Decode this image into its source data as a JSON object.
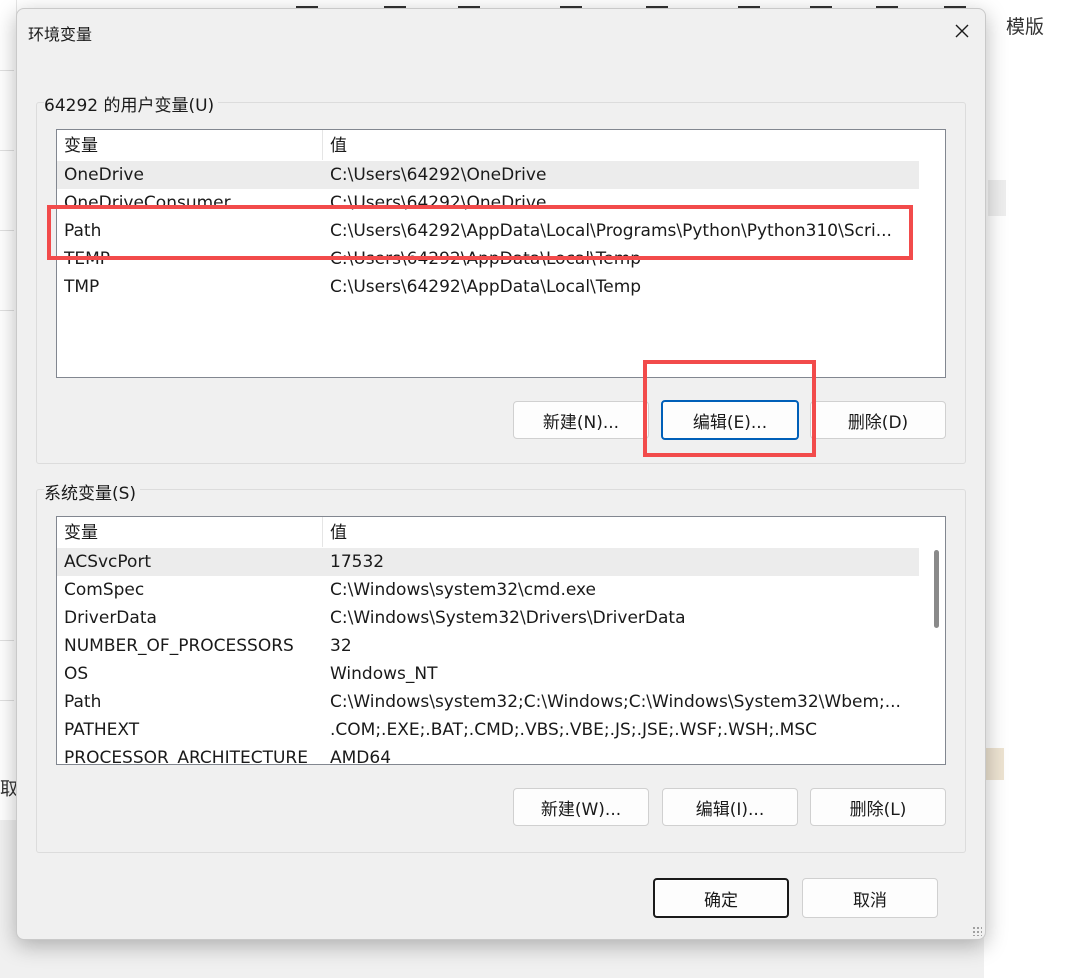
{
  "background": {
    "template_label": "模版",
    "left_partial_text": "取"
  },
  "dialog": {
    "title": "环境变量",
    "user_group": {
      "label": "64292 的用户变量(U)",
      "columns": [
        "变量",
        "值"
      ],
      "rows": [
        {
          "name": "OneDrive",
          "value": "C:\\Users\\64292\\OneDrive"
        },
        {
          "name": "OneDriveConsumer",
          "value": "C:\\Users\\64292\\OneDrive"
        },
        {
          "name": "Path",
          "value": "C:\\Users\\64292\\AppData\\Local\\Programs\\Python\\Python310\\Scri..."
        },
        {
          "name": "TEMP",
          "value": "C:\\Users\\64292\\AppData\\Local\\Temp"
        },
        {
          "name": "TMP",
          "value": "C:\\Users\\64292\\AppData\\Local\\Temp"
        }
      ],
      "buttons": {
        "new": "新建(N)...",
        "edit": "编辑(E)...",
        "delete": "删除(D)"
      }
    },
    "system_group": {
      "label": "系统变量(S)",
      "columns": [
        "变量",
        "值"
      ],
      "rows": [
        {
          "name": "ACSvcPort",
          "value": "17532"
        },
        {
          "name": "ComSpec",
          "value": "C:\\Windows\\system32\\cmd.exe"
        },
        {
          "name": "DriverData",
          "value": "C:\\Windows\\System32\\Drivers\\DriverData"
        },
        {
          "name": "NUMBER_OF_PROCESSORS",
          "value": "32"
        },
        {
          "name": "OS",
          "value": "Windows_NT"
        },
        {
          "name": "Path",
          "value": "C:\\Windows\\system32;C:\\Windows;C:\\Windows\\System32\\Wbem;..."
        },
        {
          "name": "PATHEXT",
          "value": ".COM;.EXE;.BAT;.CMD;.VBS;.VBE;.JS;.JSE;.WSF;.WSH;.MSC"
        },
        {
          "name": "PROCESSOR_ARCHITECTURE",
          "value": "AMD64"
        }
      ],
      "buttons": {
        "new": "新建(W)...",
        "edit": "编辑(I)...",
        "delete": "删除(L)"
      }
    },
    "ok_label": "确定",
    "cancel_label": "取消"
  },
  "annotation_color": "#f24b4b"
}
